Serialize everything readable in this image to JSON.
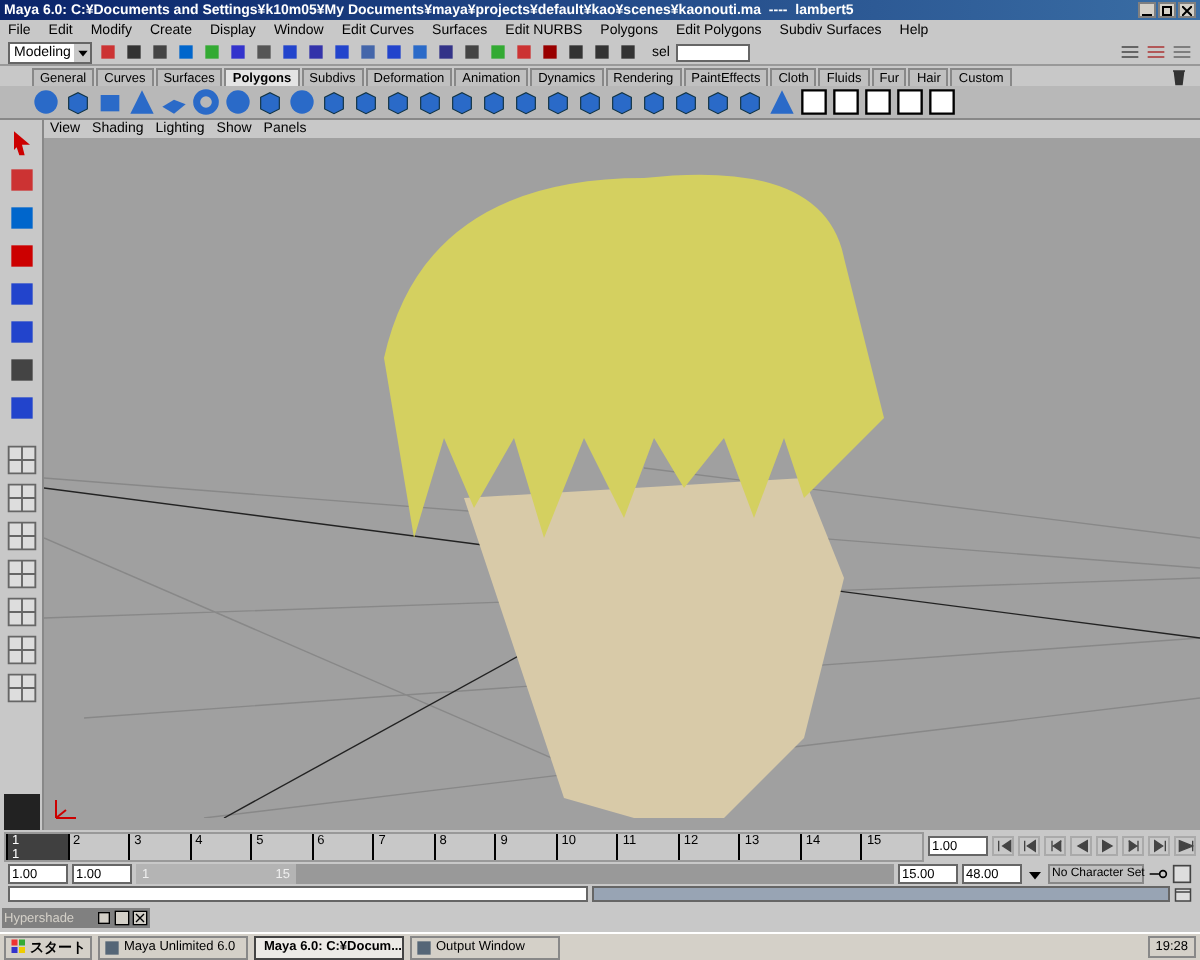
{
  "window": {
    "title": "Maya 6.0: C:¥Documents and Settings¥k10m05¥My Documents¥maya¥projects¥default¥kao¥scenes¥kaonouti.ma  ----  lambert5"
  },
  "menus": [
    "File",
    "Edit",
    "Modify",
    "Create",
    "Display",
    "Window",
    "Edit Curves",
    "Surfaces",
    "Edit NURBS",
    "Polygons",
    "Edit Polygons",
    "Subdiv Surfaces",
    "Help"
  ],
  "status_line": {
    "mode": "Modeling",
    "selection_label": "sel"
  },
  "shelf_tabs": [
    {
      "label": "General",
      "selected": false
    },
    {
      "label": "Curves",
      "selected": false
    },
    {
      "label": "Surfaces",
      "selected": false
    },
    {
      "label": "Polygons",
      "selected": true
    },
    {
      "label": "Subdivs",
      "selected": false
    },
    {
      "label": "Deformation",
      "selected": false
    },
    {
      "label": "Animation",
      "selected": false
    },
    {
      "label": "Dynamics",
      "selected": false
    },
    {
      "label": "Rendering",
      "selected": false
    },
    {
      "label": "PaintEffects",
      "selected": false
    },
    {
      "label": "Cloth",
      "selected": false
    },
    {
      "label": "Fluids",
      "selected": false
    },
    {
      "label": "Fur",
      "selected": false
    },
    {
      "label": "Hair",
      "selected": false
    },
    {
      "label": "Custom",
      "selected": false
    }
  ],
  "panel_menus": [
    "View",
    "Shading",
    "Lighting",
    "Show",
    "Panels"
  ],
  "timeline": {
    "frames": [
      {
        "label": "1",
        "selected": true
      },
      {
        "label": "2",
        "selected": false
      },
      {
        "label": "3",
        "selected": false
      },
      {
        "label": "4",
        "selected": false
      },
      {
        "label": "5",
        "selected": false
      },
      {
        "label": "6",
        "selected": false
      },
      {
        "label": "7",
        "selected": false
      },
      {
        "label": "8",
        "selected": false
      },
      {
        "label": "9",
        "selected": false
      },
      {
        "label": "10",
        "selected": false
      },
      {
        "label": "11",
        "selected": false
      },
      {
        "label": "12",
        "selected": false
      },
      {
        "label": "13",
        "selected": false
      },
      {
        "label": "14",
        "selected": false
      },
      {
        "label": "15",
        "selected": false
      }
    ],
    "current_frame": "1",
    "current_time": "1.00"
  },
  "range": {
    "start_time": "1.00",
    "playback_start": "1.00",
    "slider_start": "1",
    "slider_end": "15",
    "playback_end": "15.00",
    "end_time": "48.00",
    "character_set": "No Character Set"
  },
  "minimized_window": {
    "title": "Hypershade"
  },
  "taskbar": {
    "start": "スタート",
    "tasks": [
      {
        "label": "Maya Unlimited 6.0",
        "selected": false
      },
      {
        "label": "Maya 6.0: C:¥Docum...",
        "selected": true
      },
      {
        "label": "Output Window",
        "selected": false
      }
    ],
    "clock": "19:28"
  }
}
